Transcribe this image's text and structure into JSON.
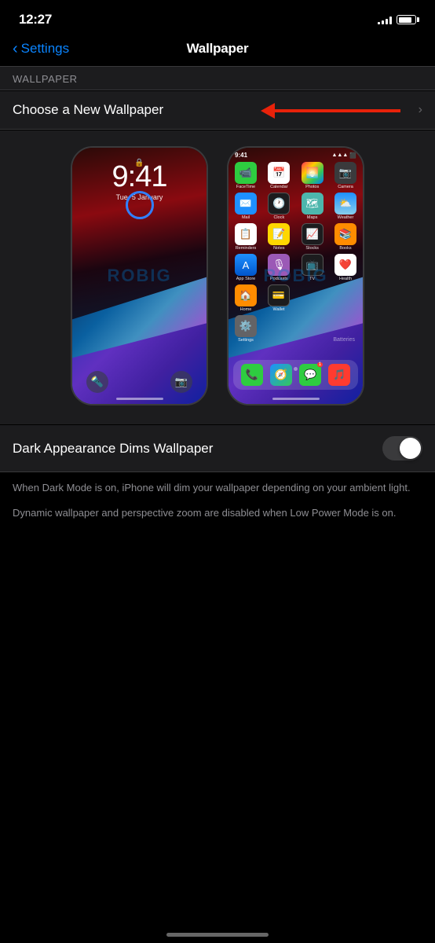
{
  "status": {
    "time": "12:27"
  },
  "nav": {
    "back_label": "Settings",
    "title": "Wallpaper"
  },
  "section_header": "WALLPAPER",
  "choose_row": {
    "label": "Choose a New Wallpaper"
  },
  "toggle_row": {
    "label": "Dark Appearance Dims Wallpaper"
  },
  "descriptions": [
    "When Dark Mode is on, iPhone will dim your wallpaper depending on your ambient light.",
    "Dynamic wallpaper and perspective zoom are disabled when Low Power Mode is on."
  ],
  "lock_screen": {
    "time": "9:41",
    "date": "Tue, 5 January"
  },
  "home_screen": {
    "time": "9:41"
  },
  "apps": {
    "row1": [
      {
        "label": "FaceTime",
        "color": "#2ecc40",
        "char": "📹"
      },
      {
        "label": "Calendar",
        "color": "#fff",
        "char": "📅"
      },
      {
        "label": "Photos",
        "color": "#fff",
        "char": "🌅"
      },
      {
        "label": "Camera",
        "color": "#333",
        "char": "📷"
      }
    ],
    "row2": [
      {
        "label": "Mail",
        "color": "#1e90ff",
        "char": "✉️"
      },
      {
        "label": "Clock",
        "color": "#333",
        "char": "🕐"
      },
      {
        "label": "Maps",
        "color": "#4ea",
        "char": "🗺"
      },
      {
        "label": "Weather",
        "color": "#87ceeb",
        "char": "⛅"
      }
    ],
    "row3": [
      {
        "label": "Reminders",
        "color": "#fff",
        "char": "📋"
      },
      {
        "label": "Notes",
        "color": "#ffd700",
        "char": "📝"
      },
      {
        "label": "Stocks",
        "color": "#333",
        "char": "📈"
      },
      {
        "label": "Books",
        "color": "#ff8c00",
        "char": "📚"
      }
    ],
    "row4": [
      {
        "label": "App Store",
        "color": "#1e90ff",
        "char": "🅐"
      },
      {
        "label": "Podcasts",
        "color": "#9b59b6",
        "char": "🎙"
      },
      {
        "label": "TV",
        "color": "#333",
        "char": "📺"
      },
      {
        "label": "Health",
        "color": "#fff",
        "char": "❤️"
      }
    ],
    "row5": [
      {
        "label": "Home",
        "color": "#ff8c00",
        "char": "🏠"
      },
      {
        "label": "Wallet",
        "color": "#333",
        "char": "💳"
      }
    ],
    "row6": [
      {
        "label": "Settings",
        "color": "#636366",
        "char": "⚙️"
      }
    ],
    "dock": [
      {
        "label": "Phone",
        "color": "#2ecc40",
        "char": "📞"
      },
      {
        "label": "Safari",
        "color": "#1e90ff",
        "char": "🧭"
      },
      {
        "label": "Messages",
        "color": "#2ecc40",
        "char": "💬"
      },
      {
        "label": "Music",
        "color": "#ff3b30",
        "char": "🎵"
      }
    ]
  },
  "watermark": "ROBIG...",
  "colors": {
    "background": "#000000",
    "nav_back": "#0a84ff",
    "section_bg": "#1c1c1e",
    "row_bg": "#1c1c1e",
    "separator": "#38383a",
    "toggle_off": "#3a3a3c",
    "text_secondary": "#8e8e93"
  }
}
